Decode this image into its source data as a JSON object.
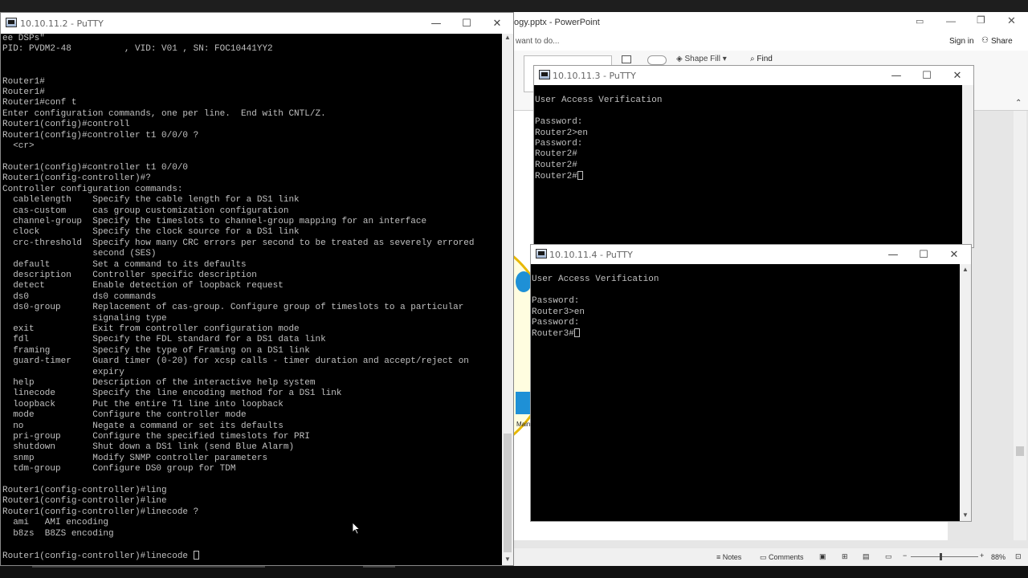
{
  "putty_main": {
    "title": "10.10.11.2 - PuTTY",
    "lines": [
      "ee DSPs\"",
      "PID: PVDM2-48          , VID: V01 , SN: FOC10441YY2",
      "",
      "",
      "Router1#",
      "Router1#",
      "Router1#conf t",
      "Enter configuration commands, one per line.  End with CNTL/Z.",
      "Router1(config)#controll",
      "Router1(config)#controller t1 0/0/0 ?",
      "  <cr>",
      "",
      "Router1(config)#controller t1 0/0/0",
      "Router1(config-controller)#?",
      "Controller configuration commands:",
      "  cablelength    Specify the cable length for a DS1 link",
      "  cas-custom     cas group customization configuration",
      "  channel-group  Specify the timeslots to channel-group mapping for an interface",
      "  clock          Specify the clock source for a DS1 link",
      "  crc-threshold  Specify how many CRC errors per second to be treated as severely errored",
      "                 second (SES)",
      "  default        Set a command to its defaults",
      "  description    Controller specific description",
      "  detect         Enable detection of loopback request",
      "  ds0            ds0 commands",
      "  ds0-group      Replacement of cas-group. Configure group of timeslots to a particular",
      "                 signaling type",
      "  exit           Exit from controller configuration mode",
      "  fdl            Specify the FDL standard for a DS1 data link",
      "  framing        Specify the type of Framing on a DS1 link",
      "  guard-timer    Guard timer (0-20) for xcsp calls - timer duration and accept/reject on",
      "                 expiry",
      "  help           Description of the interactive help system",
      "  linecode       Specify the line encoding method for a DS1 link",
      "  loopback       Put the entire T1 line into loopback",
      "  mode           Configure the controller mode",
      "  no             Negate a command or set its defaults",
      "  pri-group      Configure the specified timeslots for PRI",
      "  shutdown       Shut down a DS1 link (send Blue Alarm)",
      "  snmp           Modify SNMP controller parameters",
      "  tdm-group      Configure DS0 group for TDM",
      "",
      "Router1(config-controller)#ling",
      "Router1(config-controller)#line",
      "Router1(config-controller)#linecode ?",
      "  ami   AMI encoding",
      "  b8zs  B8ZS encoding",
      "",
      "Router1(config-controller)#linecode "
    ]
  },
  "putty_r2": {
    "title": "10.10.11.3 - PuTTY",
    "lines": [
      "",
      "User Access Verification",
      "",
      "Password:",
      "Router2>en",
      "Password:",
      "Router2#",
      "Router2#",
      "Router2#"
    ]
  },
  "putty_r3": {
    "title": "10.10.11.4 - PuTTY",
    "lines": [
      "",
      "User Access Verification",
      "",
      "Password:",
      "Router3>en",
      "Password:",
      "Router3#"
    ]
  },
  "powerpoint": {
    "title": "ogy.pptx - PowerPoint",
    "tell_me": "want to do...",
    "sign_in": "Sign in",
    "share": "Share",
    "shape_fill": "Shape Fill",
    "find": "Find",
    "slide_label_main": "Main",
    "status": {
      "notes": "Notes",
      "comments": "Comments",
      "zoom": "88%"
    }
  },
  "colors": {
    "terminal_bg": "#000000",
    "terminal_fg": "#c0c0c0",
    "ppt_gold": "#e8b800"
  }
}
